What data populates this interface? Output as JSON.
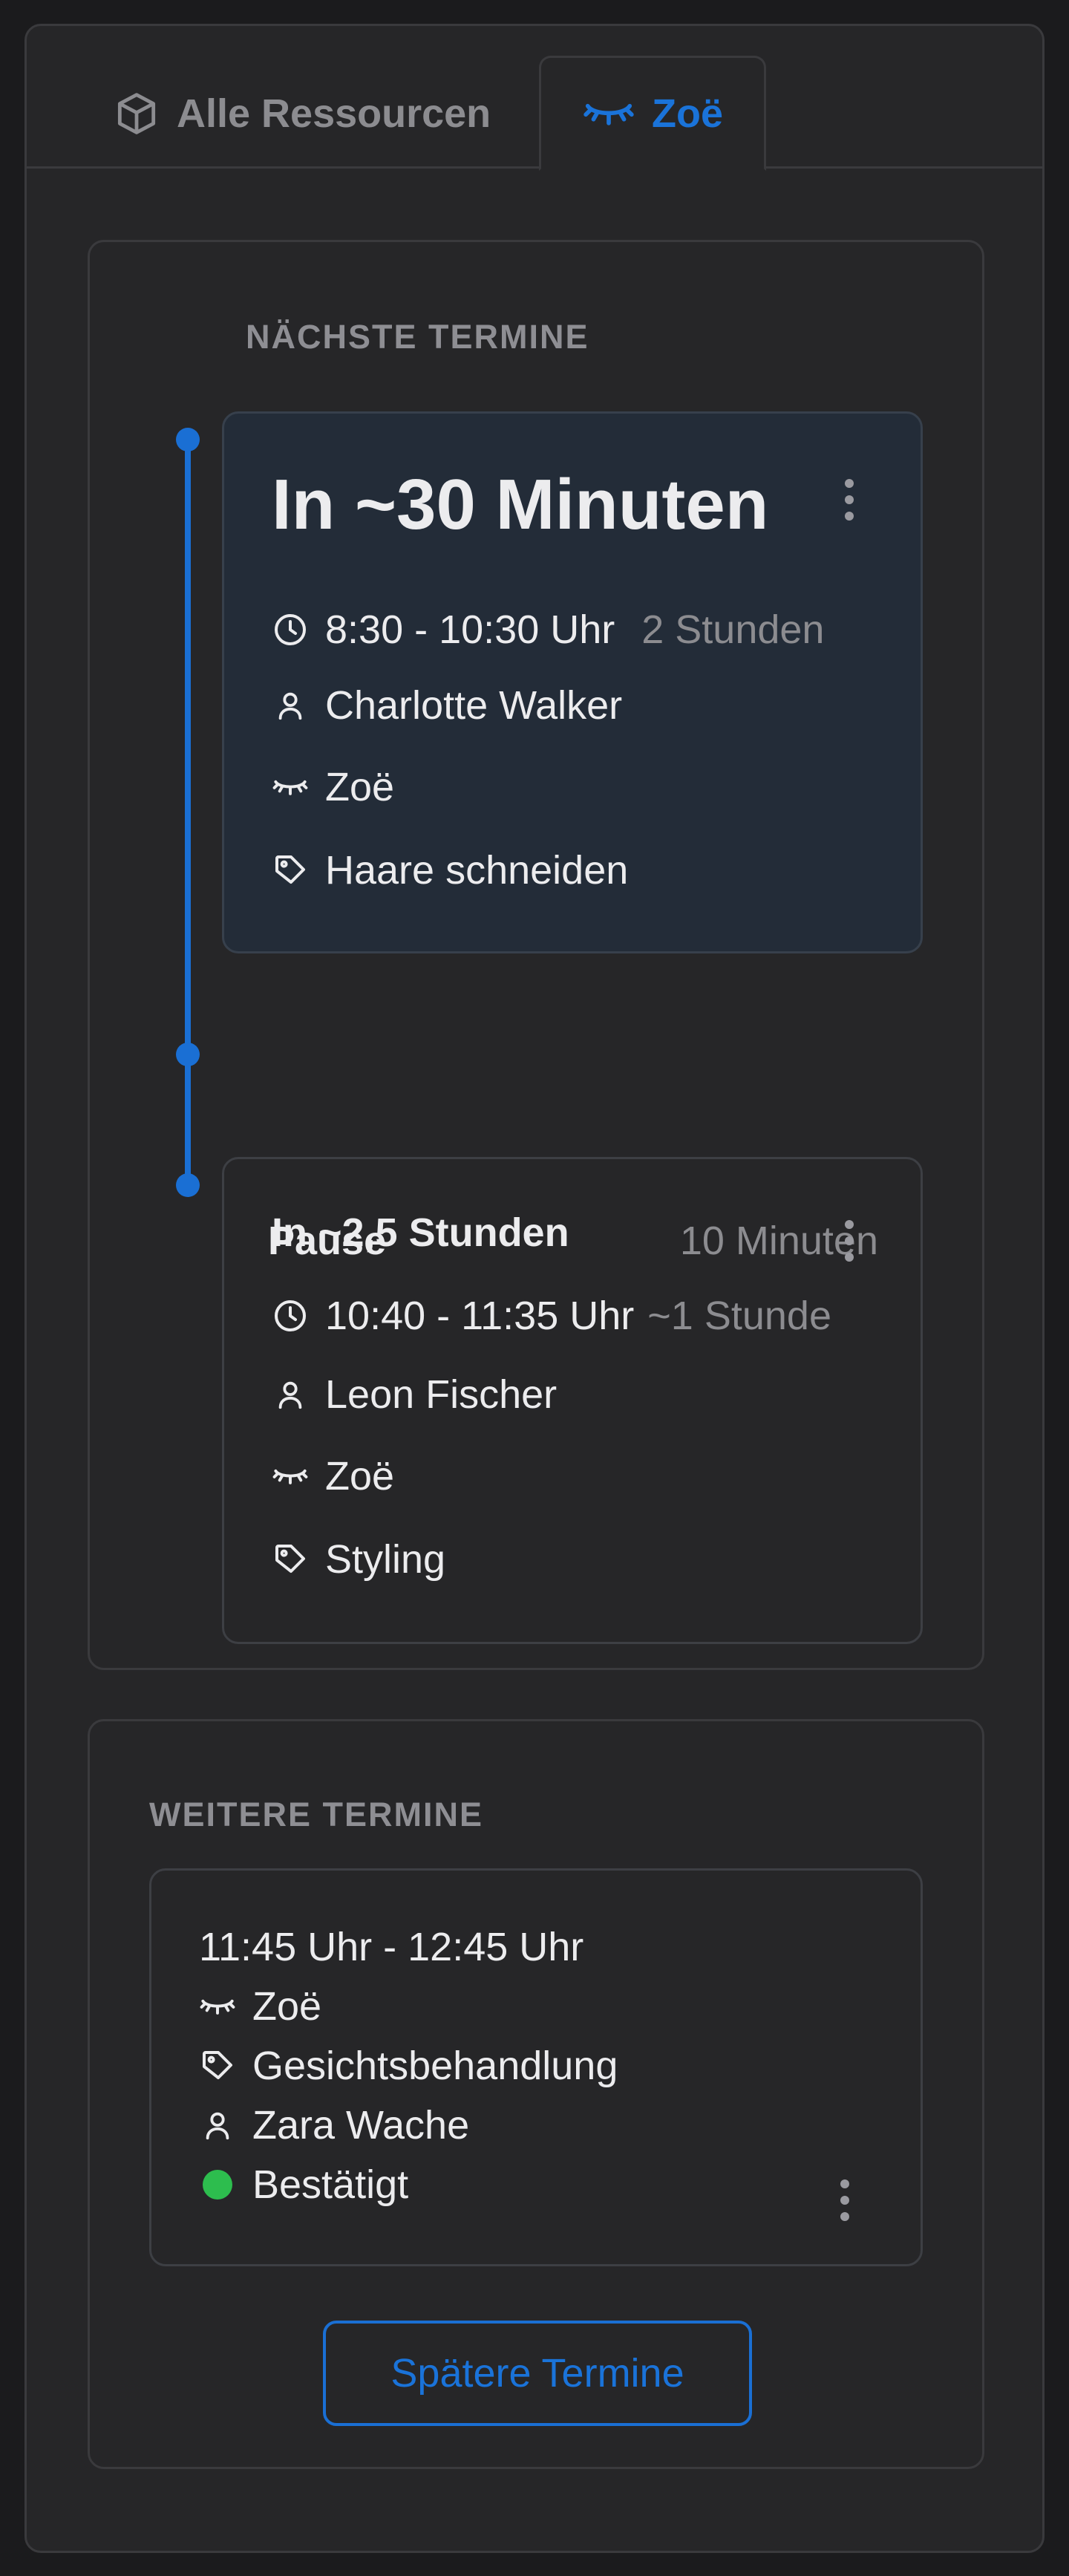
{
  "tabs": {
    "all": {
      "label": "Alle Ressourcen",
      "icon": "cube-icon"
    },
    "zoe": {
      "label": "Zoë",
      "icon": "eyelash-icon",
      "active": true
    }
  },
  "next": {
    "title": "NÄCHSTE TERMINE",
    "appointments": [
      {
        "heading": "In ~30 Minuten",
        "time": "8:30 - 10:30 Uhr",
        "duration": "2 Stunden",
        "client": "Charlotte Walker",
        "resource": "Zoë",
        "service": "Haare schneiden"
      },
      {
        "heading": "In ~2,5 Stunden",
        "time": "10:40 - 11:35 Uhr",
        "duration": "~1 Stunde",
        "client": "Leon Fischer",
        "resource": "Zoë",
        "service": "Styling"
      }
    ],
    "pause": {
      "label": "Pause",
      "duration": "10 Minuten"
    }
  },
  "more": {
    "title": "WEITERE TERMINE",
    "appointment": {
      "time": "11:45 Uhr - 12:45 Uhr",
      "resource": "Zoë",
      "service": "Gesichtsbehandlung",
      "client": "Zara Wache",
      "status": "Bestätigt"
    },
    "later_button": "Spätere Termine"
  },
  "colors": {
    "accent": "#1a6fd4",
    "status_confirmed": "#2dbd4e",
    "active_card": "#232c38"
  }
}
